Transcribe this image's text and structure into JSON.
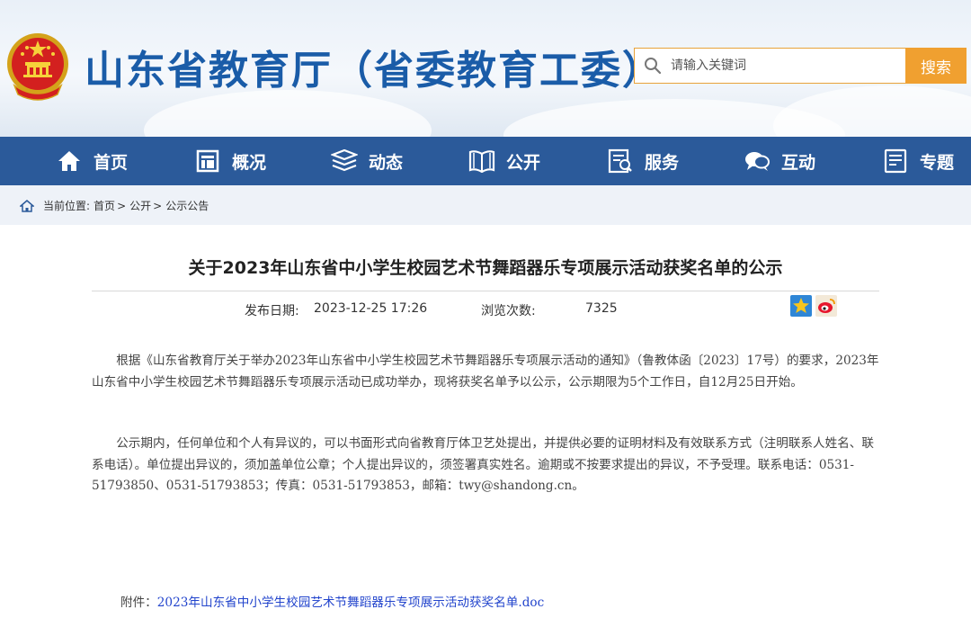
{
  "header": {
    "site_title": "山东省教育厅（省委教育工委）",
    "search_placeholder": "请输入关键词",
    "search_button": "搜索"
  },
  "nav": {
    "items": [
      {
        "label": "首页",
        "icon": "home-icon"
      },
      {
        "label": "概况",
        "icon": "overview-icon"
      },
      {
        "label": "动态",
        "icon": "news-icon"
      },
      {
        "label": "公开",
        "icon": "book-icon"
      },
      {
        "label": "服务",
        "icon": "service-icon"
      },
      {
        "label": "互动",
        "icon": "chat-icon"
      },
      {
        "label": "专题",
        "icon": "topic-icon"
      }
    ]
  },
  "breadcrumb": {
    "prefix": "当前位置:",
    "items": [
      "首页",
      "公开",
      "公示公告"
    ],
    "separator": ">"
  },
  "article": {
    "title": "关于2023年山东省中小学生校园艺术节舞蹈器乐专项展示活动获奖名单的公示",
    "publish_label": "发布日期:",
    "publish_date": "2023-12-25 17:26",
    "views_label": "浏览次数:",
    "views": "7325",
    "paragraphs": [
      "根据《山东省教育厅关于举办2023年山东省中小学生校园艺术节舞蹈器乐专项展示活动的通知》（鲁教体函〔2023〕17号）的要求，2023年山东省中小学生校园艺术节舞蹈器乐专项展示活动已成功举办，现将获奖名单予以公示，公示期限为5个工作日，自12月25日开始。",
      "公示期内，任何单位和个人有异议的，可以书面形式向省教育厅体卫艺处提出，并提供必要的证明材料及有效联系方式（注明联系人姓名、联系电话）。单位提出异议的，须加盖单位公章；个人提出异议的，须签署真实姓名。逾期或不按要求提出的异议，不予受理。联系电话：0531-51793850、0531-51793853；传真：0531-51793853，邮箱：twy@shandong.cn。"
    ],
    "attachment_label": "附件：",
    "attachment_link": "2023年山东省中小学生校园艺术节舞蹈器乐专项展示活动获奖名单.doc"
  },
  "colors": {
    "brand_blue": "#2b5a9a",
    "title_blue": "#1a5ca8",
    "search_orange": "#f0a030",
    "link_blue": "#2244cc"
  }
}
